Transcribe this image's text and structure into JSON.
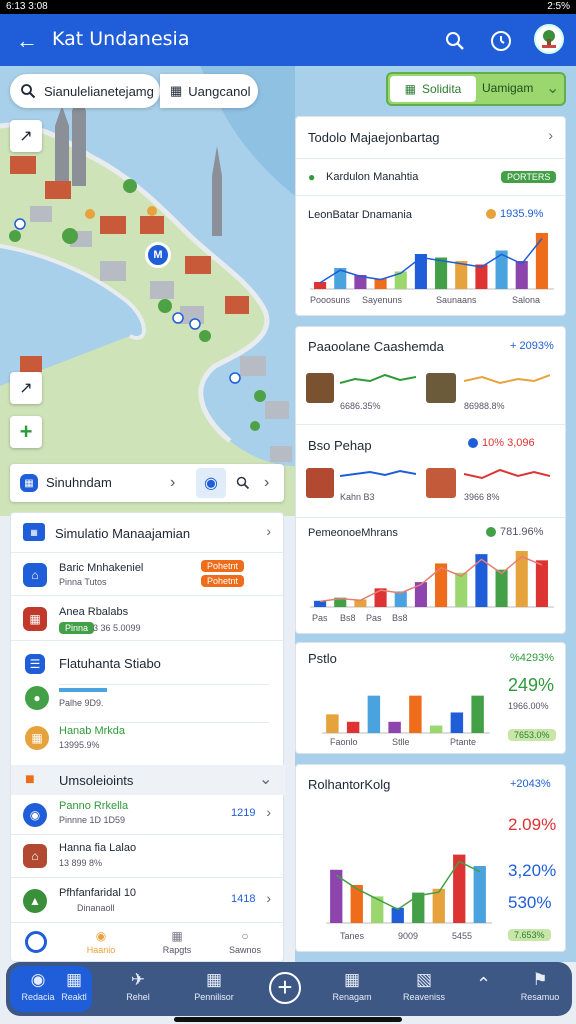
{
  "status": {
    "time": "6:13 3:08",
    "right": "2:5%"
  },
  "appbar": {
    "title": "Kat Undanesia"
  },
  "map": {
    "search_placeholder": "Sianulelianetejamg",
    "chip": "Uangcanol",
    "marker": "M",
    "panel_label": "Sinuhndam"
  },
  "tabs": {
    "left": "Solidita",
    "right": "Uamigam"
  },
  "left_list": {
    "header": "Simulatio Manaajamian",
    "items": [
      {
        "title": "Baric Mnhakeniel",
        "sub": "Pinna Tutos",
        "badge1": "Pohetnt",
        "badge2": "Pohetnt"
      },
      {
        "title": "Anea Rbalabs",
        "sub": "3 36 5.0099",
        "badge": "Pinna"
      }
    ],
    "sub_header": "Flatuhanta Stiabo",
    "sub_items": [
      {
        "title": "Palhe 9D9.",
        "sub": ""
      },
      {
        "title": "Hanab Mrkda",
        "sub": "13995.9%"
      }
    ],
    "section_header": "Umsoleioints",
    "section_items": [
      {
        "title": "Panno Rrkella",
        "sub": "Pinnne 1D 1D59",
        "value": "1219"
      },
      {
        "title": "Hanna fia Lalao",
        "sub": "13 899 8%",
        "value": ""
      },
      {
        "title": "Pfhfanfaridal 10",
        "sub": "Dinanaoll",
        "value": "1418"
      }
    ],
    "bottom_tabs": [
      "",
      "Haanio",
      "Rapgts",
      "Sawnos"
    ]
  },
  "right_panels": {
    "p1": {
      "title": "Todolo Majaejonbartag",
      "sub": "Kardulon Manahtia",
      "badge": "PORTERS",
      "chart_title": "LeonBatar Dnamania",
      "chart_value": "1935.9%",
      "legend": [
        "Pooosuns",
        "Sayenuns",
        "Saunaans",
        "Salona"
      ]
    },
    "p2": {
      "title": "Paaoolane Caashemda",
      "value": "+ 2093%",
      "sub1": "6686.35%",
      "sub2": "86988.8%"
    },
    "p3": {
      "title": "Bso Pehap",
      "value": "10% 3,096",
      "sub1": "Kahn B3",
      "sub2": "3966 8%"
    },
    "p4": {
      "title": "PemeonoeMhrans",
      "value": "781.96%",
      "cats": [
        "Pas",
        "Bs8",
        "Pas",
        "Bs8"
      ]
    },
    "p5": {
      "title": "Pstlo",
      "value": "%4293%",
      "big": "249%",
      "sub1": "1966.00%",
      "badge": "7653.0%",
      "cats": [
        "Faonlo",
        "Stlle",
        "Ptante"
      ]
    },
    "p6": {
      "title": "RolhantorKolg",
      "value": "+2043%",
      "big1": "2.09%",
      "big2": "3,20%",
      "big3": "530%",
      "badge": "7.653%",
      "cats": [
        "Tanes",
        "9009",
        "5455"
      ]
    }
  },
  "bottom_nav": [
    "Redacia",
    "Reaktl",
    "Rehel",
    "Pennilisor",
    "",
    "Renagam",
    "Reaveniss",
    "",
    "Resamuo"
  ],
  "chart_data": [
    {
      "type": "bar",
      "title": "LeonBatar Dnamania",
      "categories": [
        "Pooosuns",
        "Sayenuns",
        "Saunaans",
        "Salona"
      ],
      "series": [
        {
          "values": [
            10,
            30,
            20,
            15,
            25,
            50,
            45,
            40,
            35,
            55,
            40,
            80
          ]
        }
      ]
    },
    {
      "type": "bar",
      "title": "PemeonoeMhrans",
      "categories": [
        "Pas",
        "Bs8",
        "Pas",
        "Bs8"
      ],
      "series": [
        {
          "values": [
            10,
            15,
            12,
            30,
            25,
            40,
            70,
            55,
            85,
            60,
            90,
            75
          ]
        }
      ]
    },
    {
      "type": "bar",
      "title": "Pstlo",
      "categories": [
        "Faonlo",
        "Stlle",
        "Ptante"
      ],
      "ylim": [
        0,
        60
      ],
      "series": [
        {
          "values": [
            20,
            12,
            40,
            12,
            40,
            8,
            22,
            40
          ]
        }
      ]
    },
    {
      "type": "bar",
      "title": "RolhantorKolg",
      "categories": [
        "Tanes",
        "9009",
        "5455"
      ],
      "ylim": [
        0,
        150
      ],
      "series": [
        {
          "values": [
            70,
            50,
            35,
            20,
            40,
            45,
            90,
            75
          ]
        }
      ]
    }
  ]
}
